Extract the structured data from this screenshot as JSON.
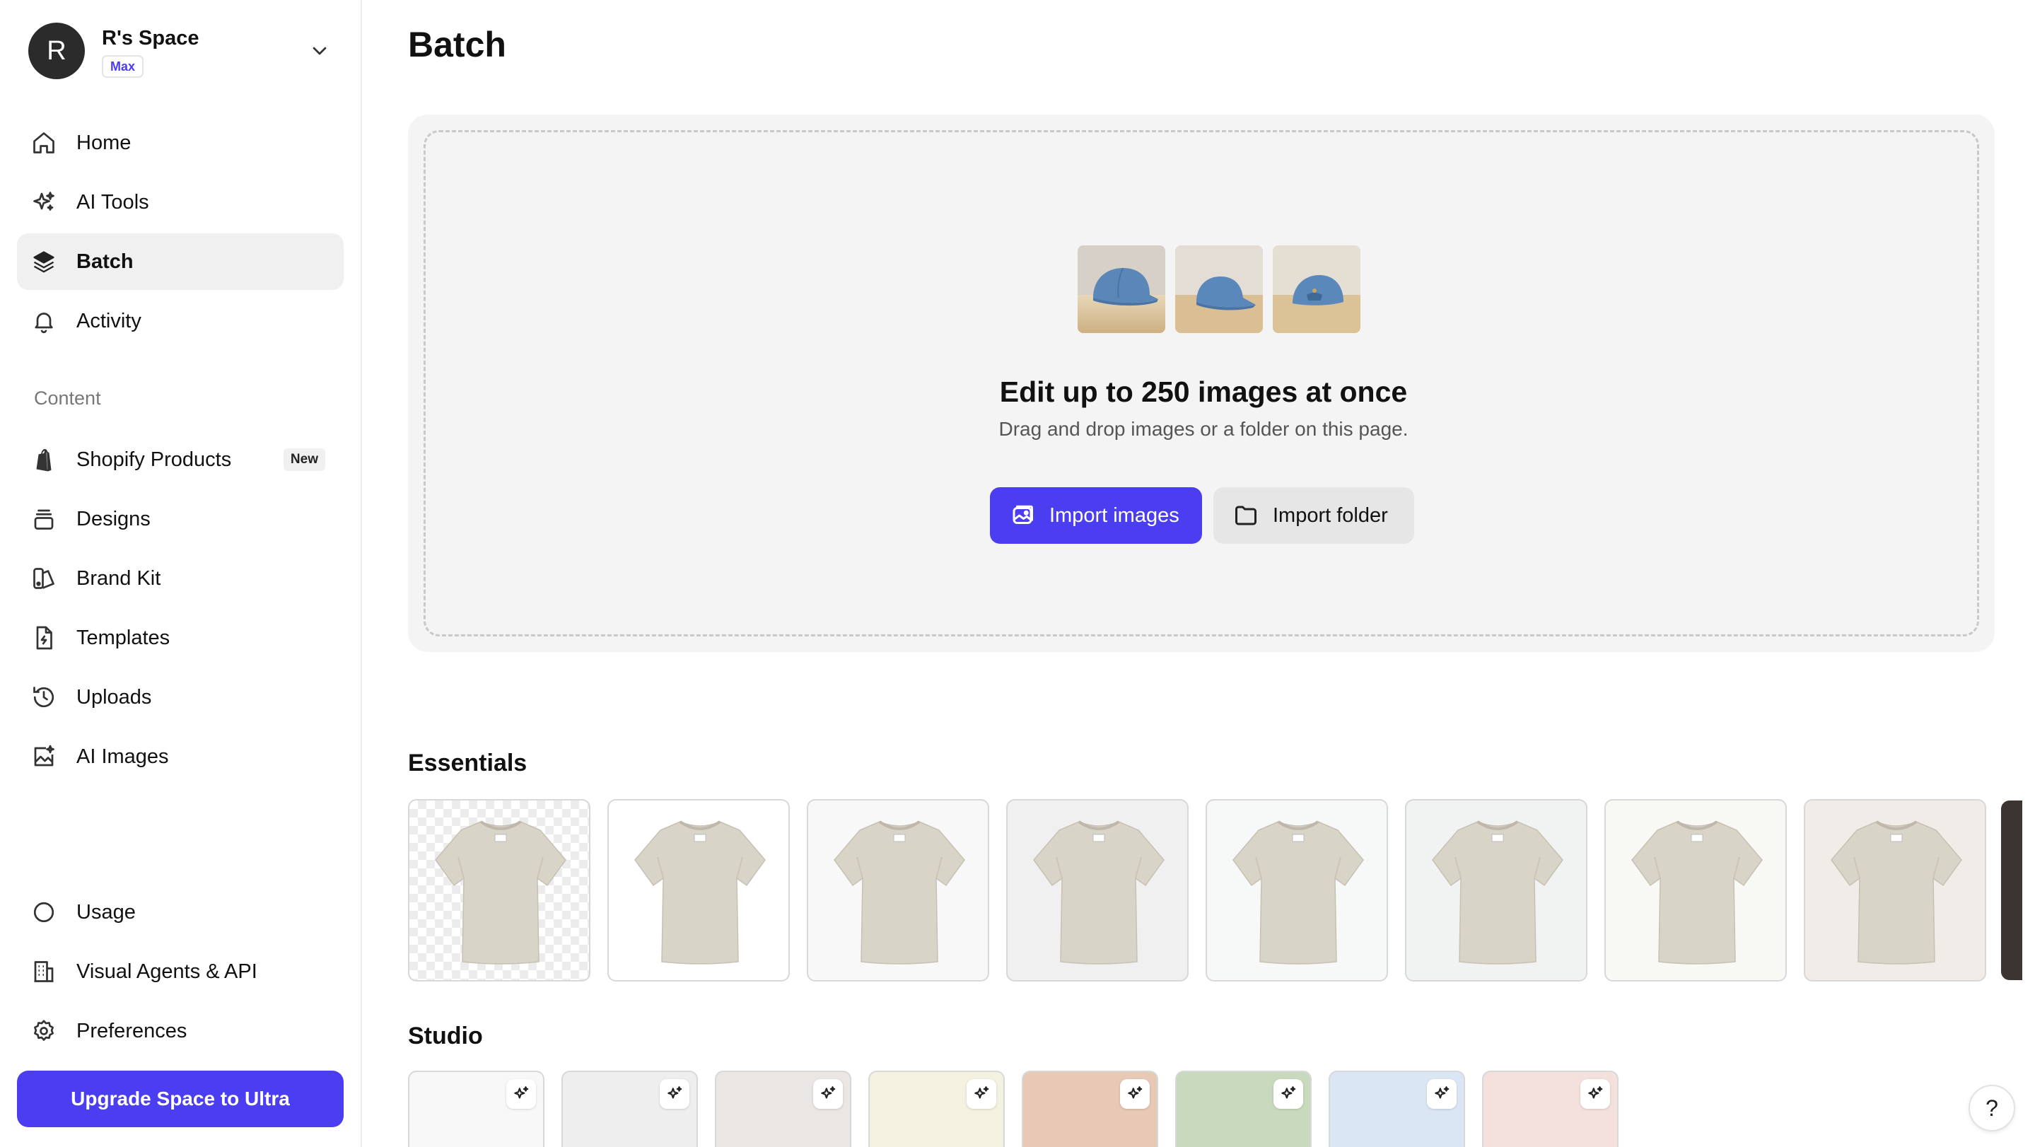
{
  "space": {
    "initial": "R",
    "name": "R's Space",
    "plan": "Max"
  },
  "nav": {
    "home": "Home",
    "ai_tools": "AI Tools",
    "batch": "Batch",
    "activity": "Activity",
    "content_section": "Content",
    "shopify": "Shopify Products",
    "shopify_badge": "New",
    "designs": "Designs",
    "brand_kit": "Brand Kit",
    "templates": "Templates",
    "uploads": "Uploads",
    "ai_images": "AI Images",
    "usage": "Usage",
    "visual_agents": "Visual Agents & API",
    "preferences": "Preferences",
    "upgrade": "Upgrade Space to Ultra"
  },
  "page": {
    "title": "Batch"
  },
  "dropzone": {
    "title": "Edit up to 250 images at once",
    "subtitle": "Drag and drop images or a folder on this page.",
    "import_images": "Import images",
    "import_folder": "Import folder"
  },
  "sections": {
    "essentials": "Essentials",
    "studio": "Studio"
  },
  "essentials_backgrounds": [
    "transparent",
    "#ffffff",
    "#f8f8f8",
    "#f0f0f0",
    "#f7f8f8",
    "#f1f2f2",
    "#f8f8f5",
    "#f0ede9"
  ],
  "studio_backgrounds": [
    "#f8f8f8",
    "#eeeeee",
    "#e9e6e3",
    "#f3f2e1",
    "#e7c9b5",
    "#c9d9be",
    "#dbe6f4",
    "#f4e1dd"
  ],
  "colors": {
    "accent": "#4b3df0",
    "tshirt": "#d9d4c8"
  },
  "help_label": "?"
}
